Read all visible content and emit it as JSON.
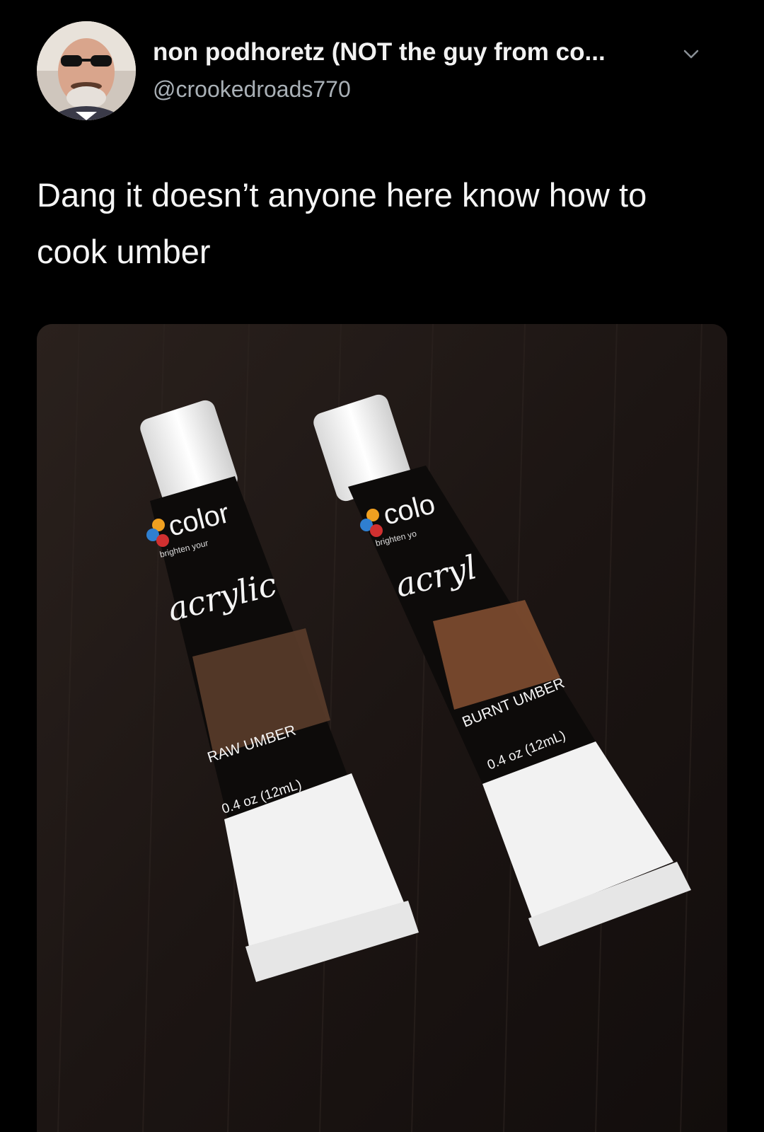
{
  "author": {
    "display_name": "non podhoretz (NOT the guy from co...",
    "handle": "@crookedroads770"
  },
  "tweet": {
    "text": "Dang it doesn’t anyone here know how to cook umber"
  },
  "photo": {
    "tube_left": {
      "brand": "color",
      "tagline": "brighten your",
      "product": "acrylic",
      "color_name": "RAW UMBER",
      "volume": "0.4 oz (12mL)"
    },
    "tube_right": {
      "brand": "colo",
      "tagline": "brighten yo",
      "product": "acryl",
      "color_name": "BURNT UMBER",
      "volume": "0.4 oz (12mL)"
    }
  },
  "colors": {
    "background": "#000000",
    "table": "#1e1715",
    "tube_body": "#0d0b0a",
    "raw_umber": "#5a3c2a",
    "burnt_umber": "#7a4a2e",
    "cap": "#f4f4f4"
  }
}
